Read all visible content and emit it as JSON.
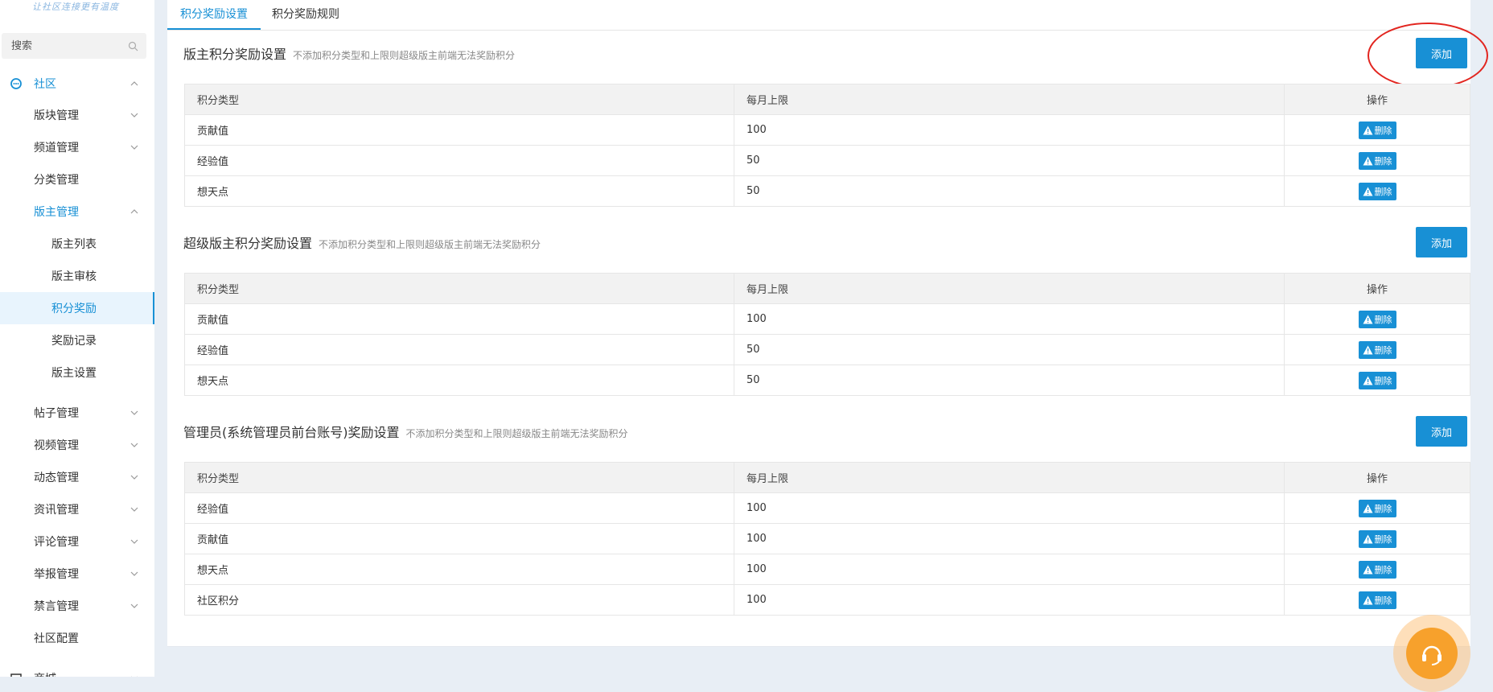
{
  "sidebar": {
    "logo_text": "让社区连接更有温度",
    "search_placeholder": "搜索",
    "group_label": "社区",
    "items": [
      {
        "label": "版块管理"
      },
      {
        "label": "频道管理"
      },
      {
        "label": "分类管理"
      },
      {
        "label": "版主管理"
      },
      {
        "label": "版主列表"
      },
      {
        "label": "版主审核"
      },
      {
        "label": "积分奖励"
      },
      {
        "label": "奖励记录"
      },
      {
        "label": "版主设置"
      },
      {
        "label": "帖子管理"
      },
      {
        "label": "视频管理"
      },
      {
        "label": "动态管理"
      },
      {
        "label": "资讯管理"
      },
      {
        "label": "评论管理"
      },
      {
        "label": "举报管理"
      },
      {
        "label": "禁言管理"
      },
      {
        "label": "社区配置"
      },
      {
        "label": "商城"
      }
    ]
  },
  "tabs": [
    {
      "label": "积分奖励设置"
    },
    {
      "label": "积分奖励规则"
    }
  ],
  "columns": {
    "type": "积分类型",
    "limit": "每月上限",
    "op": "操作"
  },
  "add_label": "添加",
  "delete_label": "删除",
  "sections": [
    {
      "title": "版主积分奖励设置",
      "hint": "不添加积分类型和上限则超级版主前端无法奖励积分",
      "rows": [
        {
          "type": "贡献值",
          "limit": "100"
        },
        {
          "type": "经验值",
          "limit": "50"
        },
        {
          "type": "想天点",
          "limit": "50"
        }
      ]
    },
    {
      "title": "超级版主积分奖励设置",
      "hint": "不添加积分类型和上限则超级版主前端无法奖励积分",
      "rows": [
        {
          "type": "贡献值",
          "limit": "100"
        },
        {
          "type": "经验值",
          "limit": "50"
        },
        {
          "type": "想天点",
          "limit": "50"
        }
      ]
    },
    {
      "title": "管理员(系统管理员前台账号)奖励设置",
      "hint": "不添加积分类型和上限则超级版主前端无法奖励积分",
      "rows": [
        {
          "type": "经验值",
          "limit": "100"
        },
        {
          "type": "贡献值",
          "limit": "100"
        },
        {
          "type": "想天点",
          "limit": "100"
        },
        {
          "type": "社区积分",
          "limit": "100"
        }
      ]
    }
  ],
  "colors": {
    "accent": "#1890d5",
    "highlight_circle": "#e2251f"
  }
}
